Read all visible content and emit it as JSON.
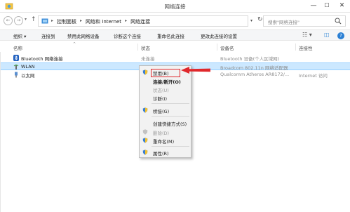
{
  "window": {
    "title": "网络连接",
    "minimize_icon": "minimize-icon",
    "maximize_icon": "maximize-icon",
    "close_icon": "close-icon",
    "controls": {
      "minimize": "—",
      "maximize": "☐",
      "close": "✕"
    }
  },
  "address": {
    "back": "←",
    "forward": "→",
    "dropdown": "▾",
    "up": "↑",
    "crumbs": [
      "控制面板",
      "网络和 Internet",
      "网络连接"
    ],
    "separator": "▸",
    "addr_dropdown": "▾",
    "refresh": "↻",
    "search_placeholder": "搜索\"网络连接\""
  },
  "toolbar": {
    "organize": "组织 ▾",
    "connect_to": "连接到",
    "disable_device": "禁用此网络设备",
    "diagnose": "诊断这个连接",
    "rename": "重命名此连接",
    "change_settings": "更改此连接的设置",
    "view_icon": "view-options-icon",
    "preview_icon": "preview-pane-icon",
    "help_icon": "help-icon",
    "right_glyphs": {
      "view": "☷ ▾",
      "preview": "◫",
      "help": "?"
    }
  },
  "columns": {
    "name": "名称",
    "status": "状态",
    "device": "设备名",
    "connectivity": "连接性"
  },
  "connections": [
    {
      "name": "Bluetooth 网络连接",
      "status": "未连接",
      "device": "Bluetooth 设备(个人区域网)",
      "connectivity": "",
      "icon": "bluetooth-icon",
      "selected": false
    },
    {
      "name": "WLAN",
      "status": "",
      "device": "Broadcom 802.11n 网络适配器",
      "connectivity": "",
      "icon": "wifi-icon",
      "selected": true
    },
    {
      "name": "以太网",
      "status": "",
      "device": "Qualcomm Atheros AR8172/...",
      "connectivity": "Internet 访问",
      "icon": "ethernet-icon",
      "selected": false
    }
  ],
  "context_menu": {
    "items": [
      {
        "label": "禁用(B)",
        "icon": "shield-icon",
        "bold": false,
        "disabled": false,
        "highlighted": true
      },
      {
        "label": "连接/断开(O)",
        "icon": "",
        "bold": true,
        "disabled": false,
        "highlighted": false
      },
      {
        "label": "状态(U)",
        "icon": "",
        "bold": false,
        "disabled": true,
        "highlighted": false
      },
      {
        "label": "诊断(I)",
        "icon": "",
        "bold": false,
        "disabled": false,
        "highlighted": false
      },
      {
        "label": "桥接(G)",
        "icon": "shield-icon",
        "bold": false,
        "disabled": false,
        "highlighted": false
      },
      {
        "label": "创建快捷方式(S)",
        "icon": "",
        "bold": false,
        "disabled": false,
        "highlighted": false
      },
      {
        "label": "删除(D)",
        "icon": "shield-icon",
        "bold": false,
        "disabled": true,
        "highlighted": false
      },
      {
        "label": "重命名(M)",
        "icon": "shield-icon",
        "bold": false,
        "disabled": false,
        "highlighted": false
      },
      {
        "label": "属性(R)",
        "icon": "shield-icon",
        "bold": false,
        "disabled": false,
        "highlighted": false
      }
    ]
  },
  "colors": {
    "selection": "#cce8ff",
    "highlight_border": "#e0282c",
    "arrow": "#e0282c"
  }
}
